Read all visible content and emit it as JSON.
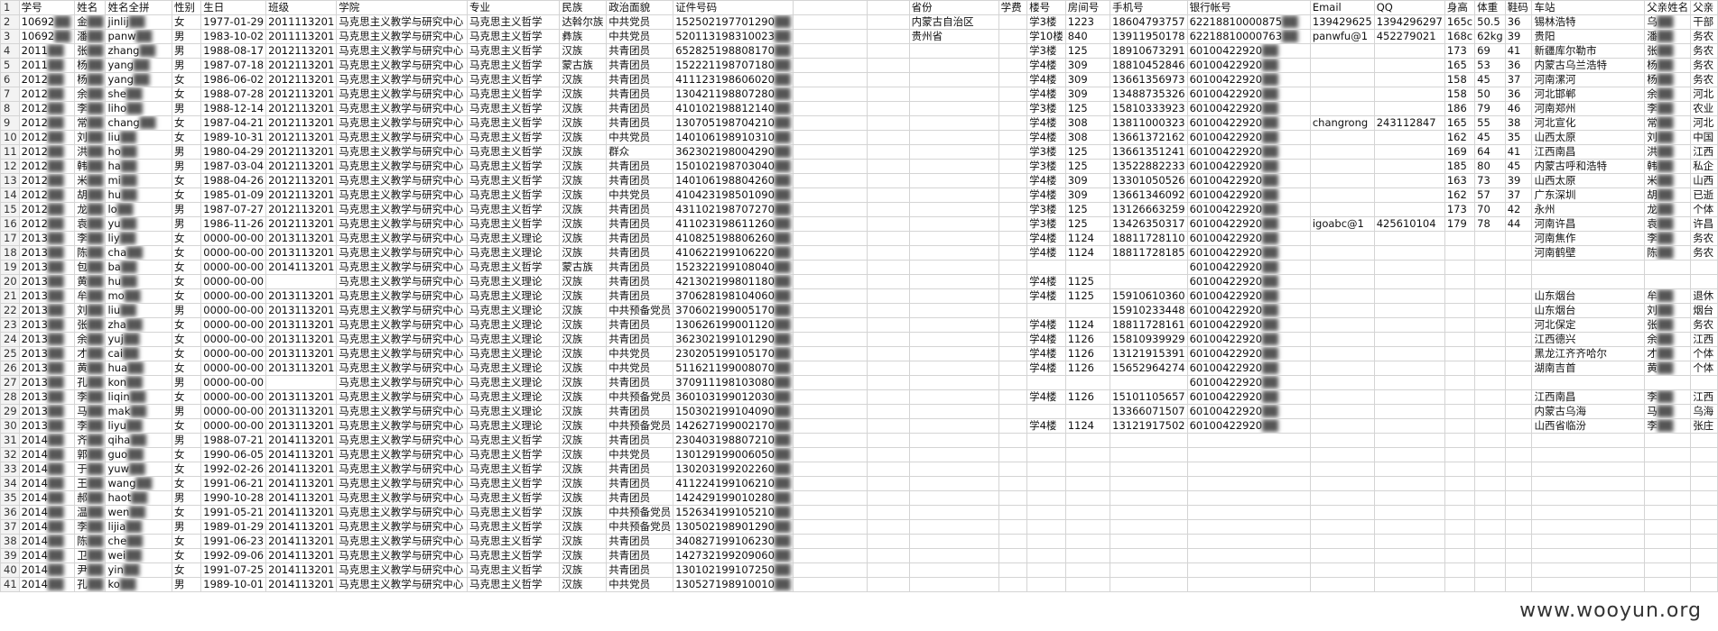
{
  "watermark": "www.wooyun.org",
  "columns": [
    "学号",
    "姓名",
    "姓名全拼",
    "性别",
    "生日",
    "班级",
    "学院",
    "专业",
    "民族",
    "政治面貌",
    "证件号码",
    "",
    "",
    "省份",
    "学费",
    "楼号",
    "房间号",
    "手机号",
    "银行帐号",
    "Email",
    "QQ",
    "身高",
    "体重",
    "鞋码",
    "车站",
    "父亲姓名",
    "父亲"
  ],
  "header_row_number": "1",
  "rows": [
    [
      "2",
      "10692",
      "金",
      "jinlij",
      "女",
      "1977-01-29",
      "2011113201",
      "马克思主义教学与研究中心",
      "马克思主义哲学",
      "达斡尔族",
      "中共党员",
      "152502197701290",
      "",
      "",
      "内蒙古自治区",
      "",
      "学3楼",
      "1223",
      "18604793757",
      "62218810000875",
      "139429625",
      "1394296297",
      "165c",
      "50.5",
      "36",
      "锡林浩特",
      "乌",
      "干部"
    ],
    [
      "3",
      "10692",
      "潘",
      "panw",
      "男",
      "1983-10-02",
      "2011113201",
      "马克思主义教学与研究中心",
      "马克思主义哲学",
      "彝族",
      "中共党员",
      "520113198310023",
      "",
      "",
      "贵州省",
      "",
      "学10楼",
      "840",
      "13911950178",
      "62218810000763",
      "panwfu@1",
      "452279021",
      "168c",
      "62kg",
      "39",
      "贵阳",
      "潘",
      "务农"
    ],
    [
      "4",
      "2011",
      "张",
      "zhang",
      "男",
      "1988-08-17",
      "2012113201",
      "马克思主义教学与研究中心",
      "马克思主义哲学",
      "汉族",
      "共青团员",
      "652825198808170",
      "",
      "",
      "",
      "",
      "学3楼",
      "125",
      "18910673291",
      "60100422920",
      "",
      "",
      "173",
      "69",
      "41",
      "新疆库尔勒市",
      "张",
      "务农"
    ],
    [
      "5",
      "2011",
      "杨",
      "yang",
      "男",
      "1987-07-18",
      "2012113201",
      "马克思主义教学与研究中心",
      "马克思主义哲学",
      "蒙古族",
      "共青团员",
      "152221198707180",
      "",
      "",
      "",
      "",
      "学4楼",
      "309",
      "18810452846",
      "60100422920",
      "",
      "",
      "165",
      "53",
      "36",
      "内蒙古乌兰浩特",
      "杨",
      "务农"
    ],
    [
      "6",
      "2012",
      "杨",
      "yang",
      "女",
      "1986-06-02",
      "2012113201",
      "马克思主义教学与研究中心",
      "马克思主义哲学",
      "汉族",
      "共青团员",
      "411123198606020",
      "",
      "",
      "",
      "",
      "学4楼",
      "309",
      "13661356973",
      "60100422920",
      "",
      "",
      "158",
      "45",
      "37",
      "河南漯河",
      "杨",
      "务农"
    ],
    [
      "7",
      "2012",
      "余",
      "she",
      "女",
      "1988-07-28",
      "2012113201",
      "马克思主义教学与研究中心",
      "马克思主义哲学",
      "汉族",
      "共青团员",
      "130421198807280",
      "",
      "",
      "",
      "",
      "学4楼",
      "309",
      "13488735326",
      "60100422920",
      "",
      "",
      "158",
      "50",
      "36",
      "河北邯郸",
      "余",
      "河北"
    ],
    [
      "8",
      "2012",
      "李",
      "liho",
      "男",
      "1988-12-14",
      "2012113201",
      "马克思主义教学与研究中心",
      "马克思主义哲学",
      "汉族",
      "共青团员",
      "410102198812140",
      "",
      "",
      "",
      "",
      "学3楼",
      "125",
      "15810333923",
      "60100422920",
      "",
      "",
      "186",
      "79",
      "46",
      "河南郑州",
      "李",
      "农业"
    ],
    [
      "9",
      "2012",
      "常",
      "chang",
      "女",
      "1987-04-21",
      "2012113201",
      "马克思主义教学与研究中心",
      "马克思主义哲学",
      "汉族",
      "共青团员",
      "130705198704210",
      "",
      "",
      "",
      "",
      "学4楼",
      "308",
      "13811000323",
      "60100422920",
      "changrong",
      "243112847",
      "165",
      "55",
      "38",
      "河北宣化",
      "常",
      "河北"
    ],
    [
      "10",
      "2012",
      "刘",
      "liu",
      "女",
      "1989-10-31",
      "2012113201",
      "马克思主义教学与研究中心",
      "马克思主义哲学",
      "汉族",
      "中共党员",
      "140106198910310",
      "",
      "",
      "",
      "",
      "学4楼",
      "308",
      "13661372162",
      "60100422920",
      "",
      "",
      "162",
      "45",
      "35",
      "山西太原",
      "刘",
      "中国"
    ],
    [
      "11",
      "2012",
      "洪",
      "ho",
      "男",
      "1980-04-29",
      "2012113201",
      "马克思主义教学与研究中心",
      "马克思主义哲学",
      "汉族",
      "群众",
      "362302198004290",
      "",
      "",
      "",
      "",
      "学3楼",
      "125",
      "13661351241",
      "60100422920",
      "",
      "",
      "169",
      "64",
      "41",
      "江西南昌",
      "洪",
      "江西"
    ],
    [
      "12",
      "2012",
      "韩",
      "ha",
      "男",
      "1987-03-04",
      "2012113201",
      "马克思主义教学与研究中心",
      "马克思主义哲学",
      "汉族",
      "共青团员",
      "150102198703040",
      "",
      "",
      "",
      "",
      "学3楼",
      "125",
      "13522882233",
      "60100422920",
      "",
      "",
      "185",
      "80",
      "45",
      "内蒙古呼和浩特",
      "韩",
      "私企"
    ],
    [
      "13",
      "2012",
      "米",
      "mi",
      "女",
      "1988-04-26",
      "2012113201",
      "马克思主义教学与研究中心",
      "马克思主义哲学",
      "汉族",
      "共青团员",
      "140106198804260",
      "",
      "",
      "",
      "",
      "学4楼",
      "309",
      "13301050526",
      "60100422920",
      "",
      "",
      "163",
      "73",
      "39",
      "山西太原",
      "米",
      "山西"
    ],
    [
      "14",
      "2012",
      "胡",
      "hu",
      "女",
      "1985-01-09",
      "2012113201",
      "马克思主义教学与研究中心",
      "马克思主义哲学",
      "汉族",
      "中共党员",
      "410423198501090",
      "",
      "",
      "",
      "",
      "学4楼",
      "309",
      "13661346092",
      "60100422920",
      "",
      "",
      "162",
      "57",
      "37",
      "广东深圳",
      "胡",
      "已逝"
    ],
    [
      "15",
      "2012",
      "龙",
      "lo",
      "男",
      "1987-07-27",
      "2012113201",
      "马克思主义教学与研究中心",
      "马克思主义哲学",
      "汉族",
      "共青团员",
      "431102198707270",
      "",
      "",
      "",
      "",
      "学3楼",
      "125",
      "13126663259",
      "60100422920",
      "",
      "",
      "173",
      "70",
      "42",
      "永州",
      "龙",
      "个体"
    ],
    [
      "16",
      "2012",
      "袁",
      "yu",
      "男",
      "1986-11-26",
      "2012113201",
      "马克思主义教学与研究中心",
      "马克思主义哲学",
      "汉族",
      "共青团员",
      "411023198611260",
      "",
      "",
      "",
      "",
      "学3楼",
      "125",
      "13426350317",
      "60100422920",
      "igoabc@1",
      "425610104",
      "179",
      "78",
      "44",
      "河南许昌",
      "袁",
      "许昌"
    ],
    [
      "17",
      "2013",
      "李",
      "liy",
      "女",
      "0000-00-00",
      "2013113201",
      "马克思主义教学与研究中心",
      "马克思主义理论",
      "汉族",
      "共青团员",
      "410825198806260",
      "",
      "",
      "",
      "",
      "学4楼",
      "1124",
      "18811728110",
      "60100422920",
      "",
      "",
      "",
      "",
      "",
      "河南焦作",
      "李",
      "务农"
    ],
    [
      "18",
      "2013",
      "陈",
      "cha",
      "女",
      "0000-00-00",
      "2013113201",
      "马克思主义教学与研究中心",
      "马克思主义理论",
      "汉族",
      "共青团员",
      "410622199106220",
      "",
      "",
      "",
      "",
      "学4楼",
      "1124",
      "18811728185",
      "60100422920",
      "",
      "",
      "",
      "",
      "",
      "河南鹤壁",
      "陈",
      "务农"
    ],
    [
      "19",
      "2013",
      "包",
      "ba",
      "女",
      "0000-00-00",
      "2014113201",
      "马克思主义教学与研究中心",
      "马克思主义哲学",
      "蒙古族",
      "共青团员",
      "152322199108040",
      "",
      "",
      "",
      "",
      "",
      "",
      "",
      "60100422920",
      "",
      "",
      "",
      "",
      "",
      "",
      "",
      ""
    ],
    [
      "20",
      "2013",
      "黄",
      "hu",
      "女",
      "0000-00-00",
      "",
      "马克思主义教学与研究中心",
      "马克思主义理论",
      "汉族",
      "共青团员",
      "421302199801180",
      "",
      "",
      "",
      "",
      "学4楼",
      "1125",
      "",
      "60100422920",
      "",
      "",
      "",
      "",
      "",
      "",
      "",
      ""
    ],
    [
      "21",
      "2013",
      "牟",
      "mo",
      "女",
      "0000-00-00",
      "2013113201",
      "马克思主义教学与研究中心",
      "马克思主义理论",
      "汉族",
      "共青团员",
      "370628198104060",
      "",
      "",
      "",
      "",
      "学4楼",
      "1125",
      "15910610360",
      "60100422920",
      "",
      "",
      "",
      "",
      "",
      "山东烟台",
      "牟",
      "退休"
    ],
    [
      "22",
      "2013",
      "刘",
      "liu",
      "男",
      "0000-00-00",
      "2013113201",
      "马克思主义教学与研究中心",
      "马克思主义理论",
      "汉族",
      "中共预备党员",
      "370602199005170",
      "",
      "",
      "",
      "",
      "",
      "",
      "15910233448",
      "60100422920",
      "",
      "",
      "",
      "",
      "",
      "山东烟台",
      "刘",
      "烟台"
    ],
    [
      "23",
      "2013",
      "张",
      "zha",
      "女",
      "0000-00-00",
      "2013113201",
      "马克思主义教学与研究中心",
      "马克思主义理论",
      "汉族",
      "共青团员",
      "130626199001120",
      "",
      "",
      "",
      "",
      "学4楼",
      "1124",
      "18811728161",
      "60100422920",
      "",
      "",
      "",
      "",
      "",
      "河北保定",
      "张",
      "务农"
    ],
    [
      "24",
      "2013",
      "余",
      "yuj",
      "女",
      "0000-00-00",
      "2013113201",
      "马克思主义教学与研究中心",
      "马克思主义理论",
      "汉族",
      "共青团员",
      "362302199101290",
      "",
      "",
      "",
      "",
      "学4楼",
      "1126",
      "15810939929",
      "60100422920",
      "",
      "",
      "",
      "",
      "",
      "江西德兴",
      "余",
      "江西"
    ],
    [
      "25",
      "2013",
      "才",
      "cai",
      "女",
      "0000-00-00",
      "2013113201",
      "马克思主义教学与研究中心",
      "马克思主义理论",
      "汉族",
      "中共党员",
      "230205199105170",
      "",
      "",
      "",
      "",
      "学4楼",
      "1126",
      "13121915391",
      "60100422920",
      "",
      "",
      "",
      "",
      "",
      "黑龙江齐齐哈尔",
      "才",
      "个体"
    ],
    [
      "26",
      "2013",
      "黄",
      "hua",
      "女",
      "0000-00-00",
      "2013113201",
      "马克思主义教学与研究中心",
      "马克思主义理论",
      "汉族",
      "中共党员",
      "511621199008070",
      "",
      "",
      "",
      "",
      "学4楼",
      "1126",
      "15652964274",
      "60100422920",
      "",
      "",
      "",
      "",
      "",
      "湖南吉首",
      "黄",
      "个体"
    ],
    [
      "27",
      "2013",
      "孔",
      "kon",
      "男",
      "0000-00-00",
      "",
      "马克思主义教学与研究中心",
      "马克思主义理论",
      "汉族",
      "共青团员",
      "370911198103080",
      "",
      "",
      "",
      "",
      "",
      "",
      "",
      "60100422920",
      "",
      "",
      "",
      "",
      "",
      "",
      "",
      ""
    ],
    [
      "28",
      "2013",
      "李",
      "liqin",
      "女",
      "0000-00-00",
      "2013113201",
      "马克思主义教学与研究中心",
      "马克思主义理论",
      "汉族",
      "中共预备党员",
      "360103199012030",
      "",
      "",
      "",
      "",
      "学4楼",
      "1126",
      "15101105657",
      "60100422920",
      "",
      "",
      "",
      "",
      "",
      "江西南昌",
      "李",
      "江西"
    ],
    [
      "29",
      "2013",
      "马",
      "mak",
      "男",
      "0000-00-00",
      "2013113201",
      "马克思主义教学与研究中心",
      "马克思主义理论",
      "汉族",
      "共青团员",
      "150302199104090",
      "",
      "",
      "",
      "",
      "",
      "",
      "13366071507",
      "60100422920",
      "",
      "",
      "",
      "",
      "",
      "内蒙古乌海",
      "马",
      "乌海"
    ],
    [
      "30",
      "2013",
      "李",
      "liyu",
      "女",
      "0000-00-00",
      "2013113201",
      "马克思主义教学与研究中心",
      "马克思主义理论",
      "汉族",
      "中共预备党员",
      "142627199002170",
      "",
      "",
      "",
      "",
      "学4楼",
      "1124",
      "13121917502",
      "60100422920",
      "",
      "",
      "",
      "",
      "",
      "山西省临汾",
      "李",
      "张庄"
    ],
    [
      "31",
      "2014",
      "齐",
      "qiha",
      "男",
      "1988-07-21",
      "2014113201",
      "马克思主义教学与研究中心",
      "马克思主义哲学",
      "汉族",
      "共青团员",
      "230403198807210",
      "",
      "",
      "",
      "",
      "",
      "",
      "",
      "",
      "",
      "",
      "",
      "",
      "",
      "",
      "",
      ""
    ],
    [
      "32",
      "2014",
      "郭",
      "guo",
      "女",
      "1990-06-05",
      "2014113201",
      "马克思主义教学与研究中心",
      "马克思主义哲学",
      "汉族",
      "中共党员",
      "130129199006050",
      "",
      "",
      "",
      "",
      "",
      "",
      "",
      "",
      "",
      "",
      "",
      "",
      "",
      "",
      "",
      ""
    ],
    [
      "33",
      "2014",
      "于",
      "yuw",
      "女",
      "1992-02-26",
      "2014113201",
      "马克思主义教学与研究中心",
      "马克思主义哲学",
      "汉族",
      "共青团员",
      "130203199202260",
      "",
      "",
      "",
      "",
      "",
      "",
      "",
      "",
      "",
      "",
      "",
      "",
      "",
      "",
      "",
      ""
    ],
    [
      "34",
      "2014",
      "王",
      "wang",
      "女",
      "1991-06-21",
      "2014113201",
      "马克思主义教学与研究中心",
      "马克思主义哲学",
      "汉族",
      "共青团员",
      "411224199106210",
      "",
      "",
      "",
      "",
      "",
      "",
      "",
      "",
      "",
      "",
      "",
      "",
      "",
      "",
      "",
      ""
    ],
    [
      "35",
      "2014",
      "郝",
      "haot",
      "男",
      "1990-10-28",
      "2014113201",
      "马克思主义教学与研究中心",
      "马克思主义哲学",
      "汉族",
      "共青团员",
      "142429199010280",
      "",
      "",
      "",
      "",
      "",
      "",
      "",
      "",
      "",
      "",
      "",
      "",
      "",
      "",
      "",
      ""
    ],
    [
      "36",
      "2014",
      "温",
      "wen",
      "女",
      "1991-05-21",
      "2014113201",
      "马克思主义教学与研究中心",
      "马克思主义哲学",
      "汉族",
      "中共预备党员",
      "152634199105210",
      "",
      "",
      "",
      "",
      "",
      "",
      "",
      "",
      "",
      "",
      "",
      "",
      "",
      "",
      "",
      ""
    ],
    [
      "37",
      "2014",
      "李",
      "lijia",
      "男",
      "1989-01-29",
      "2014113201",
      "马克思主义教学与研究中心",
      "马克思主义哲学",
      "汉族",
      "中共预备党员",
      "130502198901290",
      "",
      "",
      "",
      "",
      "",
      "",
      "",
      "",
      "",
      "",
      "",
      "",
      "",
      "",
      "",
      ""
    ],
    [
      "38",
      "2014",
      "陈",
      "che",
      "女",
      "1991-06-23",
      "2014113201",
      "马克思主义教学与研究中心",
      "马克思主义哲学",
      "汉族",
      "共青团员",
      "340827199106230",
      "",
      "",
      "",
      "",
      "",
      "",
      "",
      "",
      "",
      "",
      "",
      "",
      "",
      "",
      "",
      ""
    ],
    [
      "39",
      "2014",
      "卫",
      "wei",
      "女",
      "1992-09-06",
      "2014113201",
      "马克思主义教学与研究中心",
      "马克思主义哲学",
      "汉族",
      "共青团员",
      "142732199209060",
      "",
      "",
      "",
      "",
      "",
      "",
      "",
      "",
      "",
      "",
      "",
      "",
      "",
      "",
      "",
      ""
    ],
    [
      "40",
      "2014",
      "尹",
      "yin",
      "女",
      "1991-07-25",
      "2014113201",
      "马克思主义教学与研究中心",
      "马克思主义哲学",
      "汉族",
      "共青团员",
      "130102199107250",
      "",
      "",
      "",
      "",
      "",
      "",
      "",
      "",
      "",
      "",
      "",
      "",
      "",
      "",
      "",
      ""
    ],
    [
      "41",
      "2014",
      "孔",
      "ko",
      "男",
      "1989-10-01",
      "2014113201",
      "马克思主义教学与研究中心",
      "马克思主义哲学",
      "汉族",
      "中共党员",
      "130527198910010",
      "",
      "",
      "",
      "",
      "",
      "",
      "",
      "",
      "",
      "",
      "",
      "",
      "",
      "",
      "",
      ""
    ]
  ]
}
